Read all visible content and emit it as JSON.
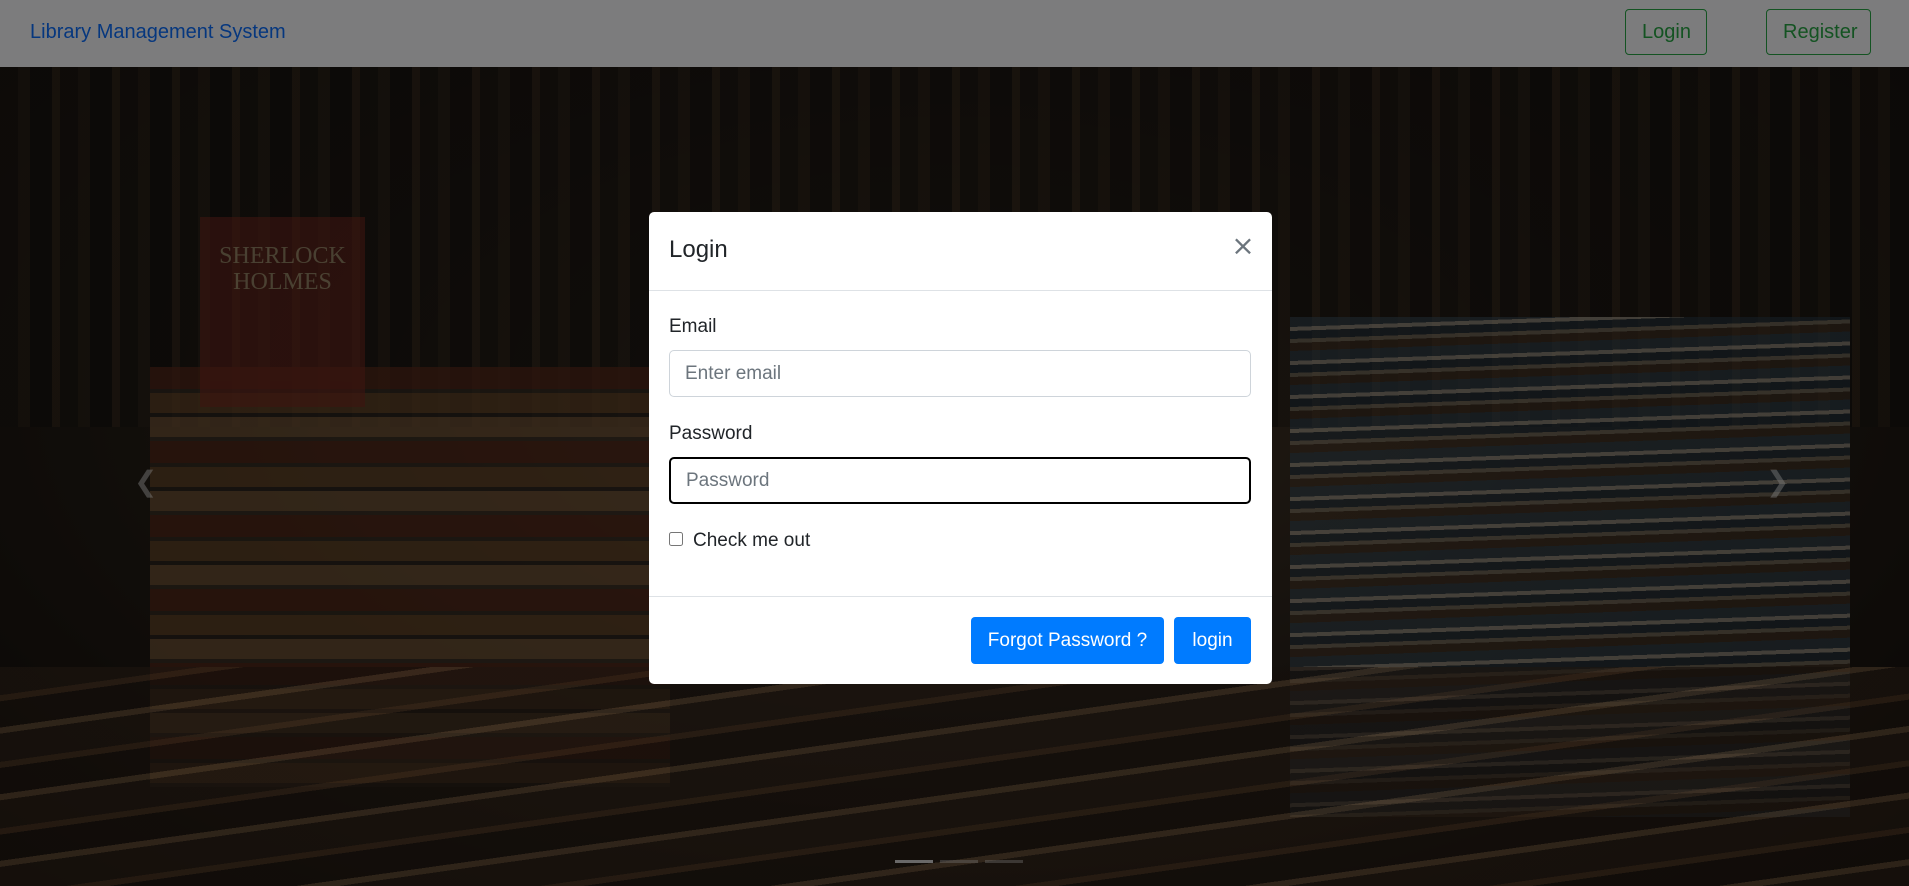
{
  "navbar": {
    "brand": "Library Management System",
    "login_label": "Login",
    "register_label": "Register"
  },
  "hero": {
    "cover_text": "SHERLOCK HOLMES",
    "prev_icon": "chevron-left-icon",
    "next_icon": "chevron-right-icon",
    "slide_count": 3,
    "active_slide": 1
  },
  "modal": {
    "title": "Login",
    "close_symbol": "×",
    "email": {
      "label": "Email",
      "placeholder": "Enter email",
      "value": ""
    },
    "password": {
      "label": "Password",
      "placeholder": "Password",
      "value": ""
    },
    "remember": {
      "label": "Check me out",
      "checked": false
    },
    "forgot_label": "Forgot Password ?",
    "login_label": "login"
  },
  "colors": {
    "brand": "#0d6efd",
    "nav_button": "#28a745",
    "primary": "#007bff",
    "backdrop": "rgba(0,0,0,0.5)"
  }
}
